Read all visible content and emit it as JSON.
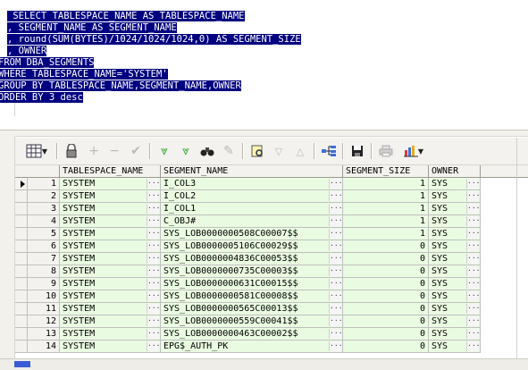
{
  "editor": {
    "sql_lines": [
      " SELECT TABLESPACE_NAME AS TABLESPACE_NAME",
      ", SEGMENT_NAME AS SEGMENT_NAME",
      ", round(SUM(BYTES)/1024/1024/1024,0) AS SEGMENT_SIZE",
      ", OWNER",
      "FROM DBA_SEGMENTS",
      "WHERE TABLESPACE_NAME='SYSTEM'",
      "GROUP BY TABLESPACE_NAME,SEGMENT_NAME,OWNER",
      "ORDER BY 3 desc"
    ],
    "selection_color": "#000080"
  },
  "toolbar": {
    "icons": [
      "grid-layout-icon",
      "lock-icon",
      "add-record-icon",
      "delete-record-icon",
      "post-check-icon",
      "fetch-next-icon",
      "fetch-last-icon",
      "find-icon",
      "clear-icon",
      "query-by-example-icon",
      "filter-down-icon",
      "filter-up-icon",
      "relations-icon",
      "save-icon",
      "print-icon",
      "chart-icon"
    ]
  },
  "grid": {
    "columns": [
      "TABLESPACE_NAME",
      "SEGMENT_NAME",
      "SEGMENT_SIZE",
      "OWNER"
    ],
    "ellipsis": "···",
    "rows": [
      {
        "n": "1",
        "ts": "SYSTEM",
        "seg": "I_COL3",
        "size": "1",
        "owner": "SYS"
      },
      {
        "n": "2",
        "ts": "SYSTEM",
        "seg": "I_COL2",
        "size": "1",
        "owner": "SYS"
      },
      {
        "n": "3",
        "ts": "SYSTEM",
        "seg": "I_COL1",
        "size": "1",
        "owner": "SYS"
      },
      {
        "n": "4",
        "ts": "SYSTEM",
        "seg": "C_OBJ#",
        "size": "1",
        "owner": "SYS"
      },
      {
        "n": "5",
        "ts": "SYSTEM",
        "seg": "SYS_LOB0000000508C00007$$",
        "size": "1",
        "owner": "SYS"
      },
      {
        "n": "6",
        "ts": "SYSTEM",
        "seg": "SYS_LOB0000005106C00029$$",
        "size": "0",
        "owner": "SYS"
      },
      {
        "n": "7",
        "ts": "SYSTEM",
        "seg": "SYS_LOB0000004836C00053$$",
        "size": "0",
        "owner": "SYS"
      },
      {
        "n": "8",
        "ts": "SYSTEM",
        "seg": "SYS_LOB0000000735C00003$$",
        "size": "0",
        "owner": "SYS"
      },
      {
        "n": "9",
        "ts": "SYSTEM",
        "seg": "SYS_LOB0000000631C00015$$",
        "size": "0",
        "owner": "SYS"
      },
      {
        "n": "10",
        "ts": "SYSTEM",
        "seg": "SYS_LOB0000000581C00008$$",
        "size": "0",
        "owner": "SYS"
      },
      {
        "n": "11",
        "ts": "SYSTEM",
        "seg": "SYS_LOB0000000565C00013$$",
        "size": "0",
        "owner": "SYS"
      },
      {
        "n": "12",
        "ts": "SYSTEM",
        "seg": "SYS_LOB0000000559C00041$$",
        "size": "0",
        "owner": "SYS"
      },
      {
        "n": "13",
        "ts": "SYSTEM",
        "seg": "SYS_LOB0000000463C00002$$",
        "size": "0",
        "owner": "SYS"
      },
      {
        "n": "14",
        "ts": "SYSTEM",
        "seg": "EPG$_AUTH_PK",
        "size": "0",
        "owner": "SYS"
      }
    ],
    "row_color": "#e9fbe1",
    "header_color": "#f3f2ee"
  }
}
